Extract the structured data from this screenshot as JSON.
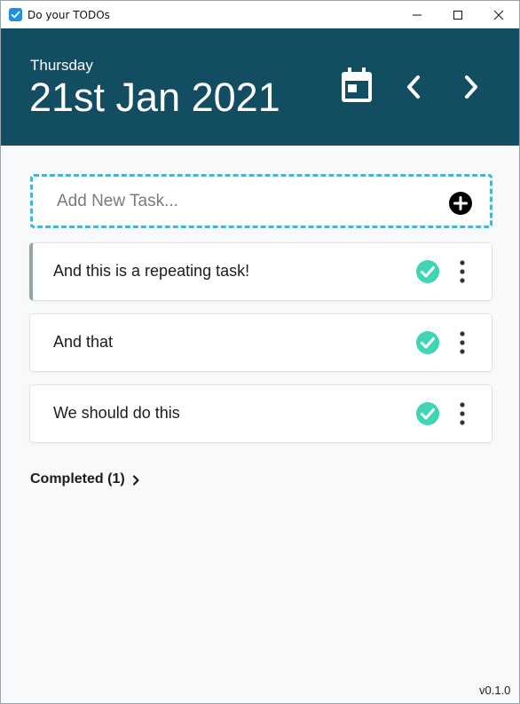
{
  "window": {
    "title": "Do your TODOs"
  },
  "header": {
    "day": "Thursday",
    "date": "21st Jan 2021"
  },
  "add_task": {
    "placeholder": "Add New Task...",
    "value": ""
  },
  "tasks": [
    {
      "text": "And this is a repeating task!",
      "repeating": true
    },
    {
      "text": "And that",
      "repeating": false
    },
    {
      "text": "We should do this",
      "repeating": false
    }
  ],
  "completed": {
    "label": "Completed (1)"
  },
  "footer": {
    "version": "v0.1.0"
  },
  "icons": {
    "app": "checkbox-icon",
    "calendar": "calendar-icon",
    "prev": "chevron-left-icon",
    "next": "chevron-right-icon",
    "add": "plus-circle-icon",
    "complete": "check-circle-icon",
    "more": "more-vertical-icon"
  },
  "colors": {
    "header_bg": "#124d62",
    "accent_dashed": "#4bb3d0",
    "check": "#3ed6b4",
    "repeating_marker": "#8eab99",
    "background": "#f8f9fb"
  }
}
